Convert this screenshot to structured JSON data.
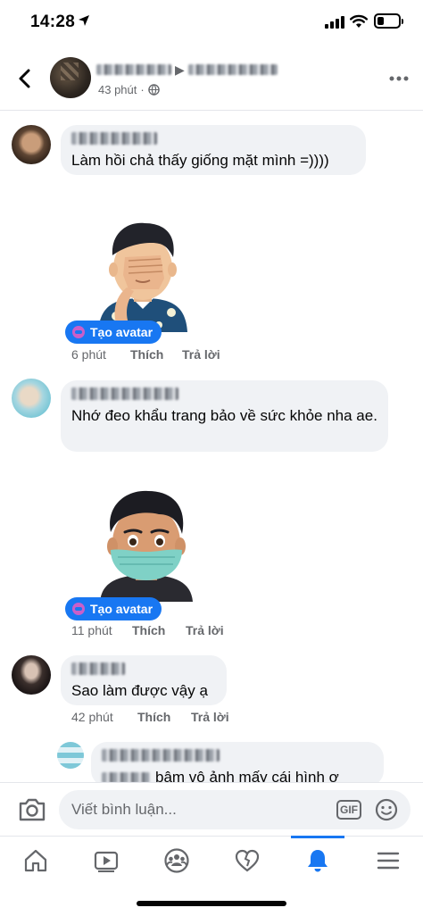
{
  "status_bar": {
    "time": "14:28"
  },
  "header": {
    "post_time": "43 phút"
  },
  "comments": [
    {
      "text": "Làm hồi chả thấy giống mặt mình =))))",
      "create_avatar_label": "Tạo avatar",
      "time": "6 phút",
      "like": "Thích",
      "reply": "Trả lời"
    },
    {
      "text": "Nhớ đeo khẩu trang bảo về sức khỏe nha ae.",
      "create_avatar_label": "Tạo avatar",
      "time": "11 phút",
      "like": "Thích",
      "reply": "Trả lời"
    },
    {
      "text": "Sao làm được vậy ạ",
      "time": "42 phút",
      "like": "Thích",
      "reply": "Trả lời"
    },
    {
      "text": "bâm vô ảnh mấy cái hình ơ"
    }
  ],
  "input": {
    "placeholder": "Viết bình luận...",
    "gif_label": "GIF"
  },
  "icons": [
    "back-icon",
    "globe-icon",
    "more-icon",
    "camera-icon",
    "emoji-icon",
    "home-icon",
    "video-icon",
    "groups-icon",
    "dating-icon",
    "bell-icon",
    "menu-icon"
  ],
  "colors": {
    "accent": "#1877f2",
    "bubble": "#f0f2f5",
    "secondary_text": "#65676b"
  }
}
